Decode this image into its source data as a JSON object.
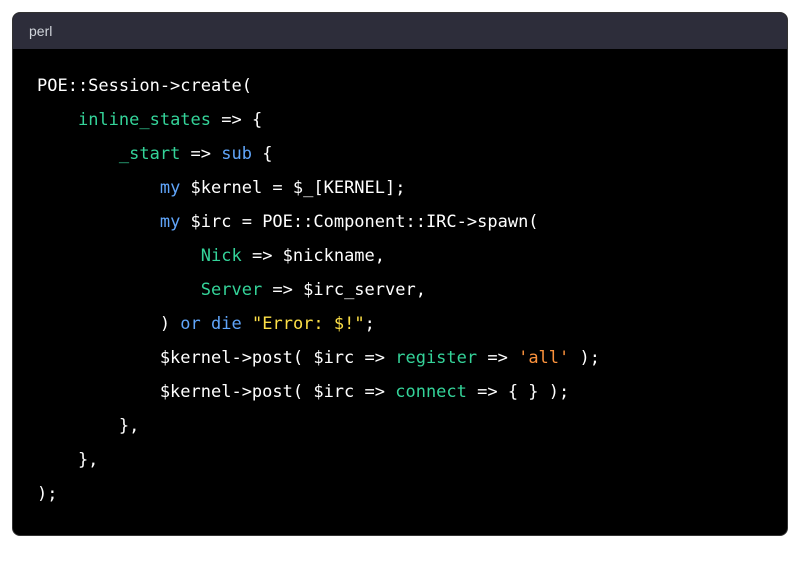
{
  "header": {
    "language": "perl"
  },
  "code": {
    "lines": [
      [
        {
          "t": "POE::Session->create(",
          "c": "c-white"
        }
      ],
      [
        {
          "t": "    ",
          "c": "c-white"
        },
        {
          "t": "inline_states",
          "c": "c-green"
        },
        {
          "t": " => {",
          "c": "c-white"
        }
      ],
      [
        {
          "t": "        ",
          "c": "c-white"
        },
        {
          "t": "_start",
          "c": "c-green"
        },
        {
          "t": " => ",
          "c": "c-white"
        },
        {
          "t": "sub",
          "c": "c-blue"
        },
        {
          "t": " {",
          "c": "c-white"
        }
      ],
      [
        {
          "t": "            ",
          "c": "c-white"
        },
        {
          "t": "my",
          "c": "c-blue"
        },
        {
          "t": " $kernel = $_[KERNEL];",
          "c": "c-white"
        }
      ],
      [
        {
          "t": "            ",
          "c": "c-white"
        },
        {
          "t": "my",
          "c": "c-blue"
        },
        {
          "t": " $irc = POE::Component::IRC->spawn(",
          "c": "c-white"
        }
      ],
      [
        {
          "t": "                ",
          "c": "c-white"
        },
        {
          "t": "Nick",
          "c": "c-green"
        },
        {
          "t": " => $nickname,",
          "c": "c-white"
        }
      ],
      [
        {
          "t": "                ",
          "c": "c-white"
        },
        {
          "t": "Server",
          "c": "c-green"
        },
        {
          "t": " => $irc_server,",
          "c": "c-white"
        }
      ],
      [
        {
          "t": "            ) ",
          "c": "c-white"
        },
        {
          "t": "or",
          "c": "c-blue"
        },
        {
          "t": " ",
          "c": "c-white"
        },
        {
          "t": "die",
          "c": "c-blue"
        },
        {
          "t": " ",
          "c": "c-white"
        },
        {
          "t": "\"Error: $!\"",
          "c": "c-yellow"
        },
        {
          "t": ";",
          "c": "c-white"
        }
      ],
      [
        {
          "t": "            $kernel->post( $irc => ",
          "c": "c-white"
        },
        {
          "t": "register",
          "c": "c-green"
        },
        {
          "t": " => ",
          "c": "c-white"
        },
        {
          "t": "'all'",
          "c": "c-orange"
        },
        {
          "t": " );",
          "c": "c-white"
        }
      ],
      [
        {
          "t": "            $kernel->post( $irc => ",
          "c": "c-white"
        },
        {
          "t": "connect",
          "c": "c-green"
        },
        {
          "t": " => { } );",
          "c": "c-white"
        }
      ],
      [
        {
          "t": "        },",
          "c": "c-white"
        }
      ],
      [
        {
          "t": "    },",
          "c": "c-white"
        }
      ],
      [
        {
          "t": ");",
          "c": "c-white"
        }
      ]
    ]
  }
}
